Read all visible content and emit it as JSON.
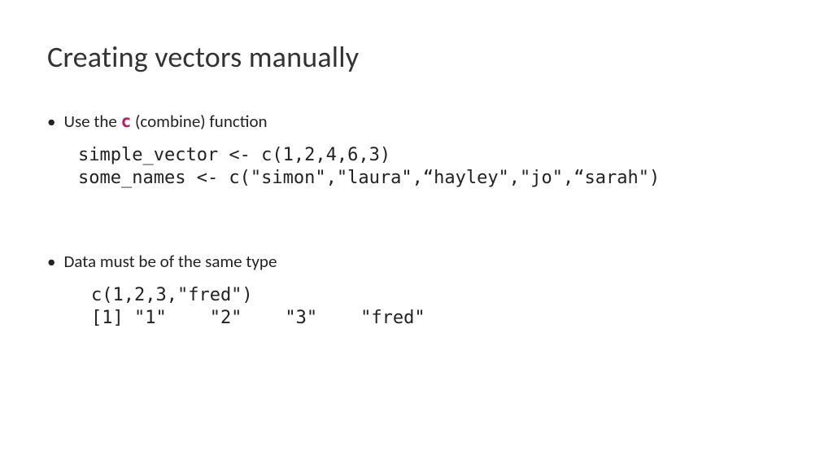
{
  "title": "Creating vectors manually",
  "bullets": [
    {
      "prefix": "Use the ",
      "code": "c",
      "suffix": " (combine) function"
    },
    {
      "prefix": "Data must be of the same type",
      "code": "",
      "suffix": ""
    }
  ],
  "code1": "simple_vector <- c(1,2,4,6,3)\nsome_names <- c(\"simon\",\"laura\",“hayley\",\"jo\",“sarah\")",
  "code2": "c(1,2,3,\"fred\")\n[1] \"1\"    \"2\"    \"3\"    \"fred\""
}
